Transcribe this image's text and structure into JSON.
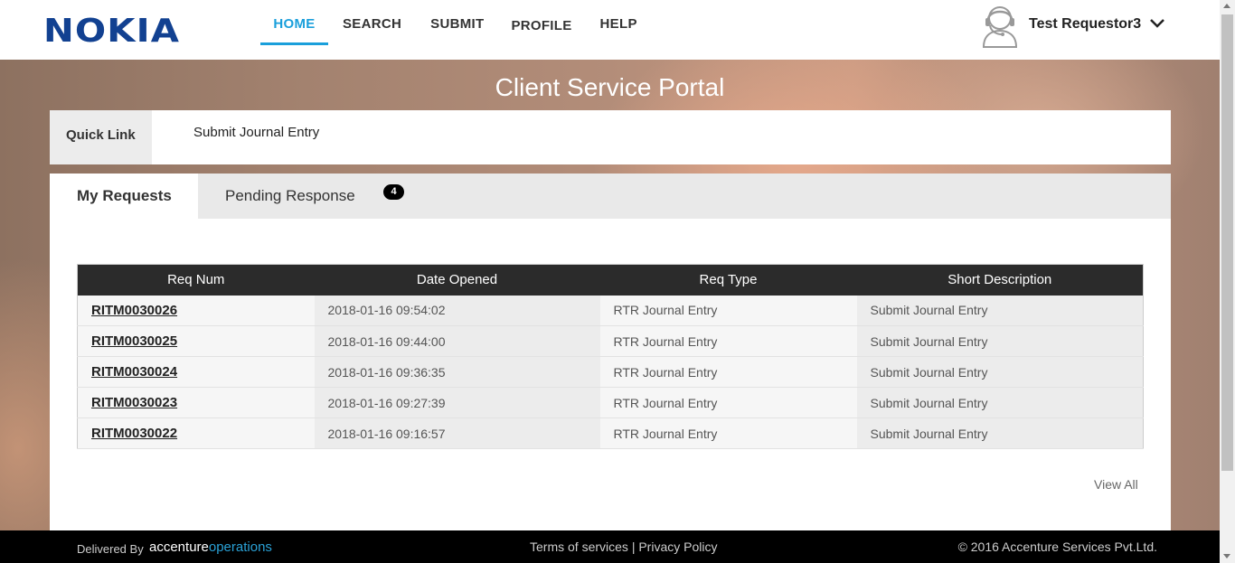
{
  "header": {
    "logo": "NOKIA",
    "nav": [
      "HOME",
      "SEARCH",
      "SUBMIT",
      "PROFILE",
      "HELP"
    ],
    "active_nav": "HOME",
    "user_name": "Test Requestor3"
  },
  "portal_title": "Client Service Portal",
  "quick_link": {
    "label": "Quick Link",
    "link": "Submit Journal Entry"
  },
  "tabs": {
    "my_requests": "My Requests",
    "pending_response": "Pending Response",
    "pending_count": "4"
  },
  "table": {
    "columns": [
      "Req Num",
      "Date Opened",
      "Req Type",
      "Short Description"
    ],
    "rows": [
      [
        "RITM0030026",
        "2018-01-16 09:54:02",
        "RTR Journal Entry",
        "Submit Journal Entry"
      ],
      [
        "RITM0030025",
        "2018-01-16 09:44:00",
        "RTR Journal Entry",
        "Submit Journal Entry"
      ],
      [
        "RITM0030024",
        "2018-01-16 09:36:35",
        "RTR Journal Entry",
        "Submit Journal Entry"
      ],
      [
        "RITM0030023",
        "2018-01-16 09:27:39",
        "RTR Journal Entry",
        "Submit Journal Entry"
      ],
      [
        "RITM0030022",
        "2018-01-16 09:16:57",
        "RTR Journal Entry",
        "Submit Journal Entry"
      ]
    ]
  },
  "view_all": "View All",
  "footer": {
    "delivered_by": "Delivered By",
    "logo_part1": "accenture",
    "logo_part2": "operations",
    "terms": "Terms of services",
    "separator": "|",
    "privacy": "Privacy Policy",
    "copyright": "© 2016 Accenture Services Pvt.Ltd."
  },
  "colors": {
    "brand_blue": "#124191",
    "nav_active": "#1a9fdb",
    "table_header": "#2b2b2b",
    "footer_bg": "#000000",
    "accenture_accent": "#2aa1d6"
  }
}
